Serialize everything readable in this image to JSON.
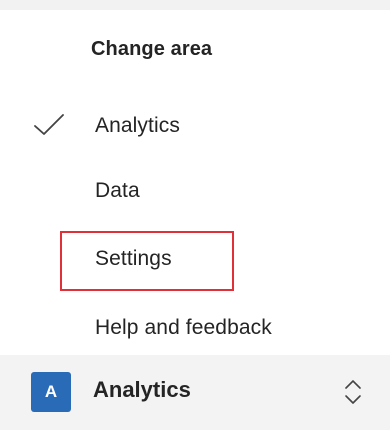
{
  "menu": {
    "header": "Change area",
    "items": [
      {
        "label": "Analytics",
        "selected": true
      },
      {
        "label": "Data",
        "selected": false
      },
      {
        "label": "Settings",
        "selected": false,
        "highlighted": true
      },
      {
        "label": "Help and feedback",
        "selected": false
      }
    ],
    "icons": {
      "check": "checkmark-icon"
    }
  },
  "area_switcher": {
    "avatar_letter": "A",
    "current_area": "Analytics",
    "icon": "chevron-up-down-icon",
    "avatar_color": "#2a6bb8"
  },
  "highlight_color": "#e0303a"
}
